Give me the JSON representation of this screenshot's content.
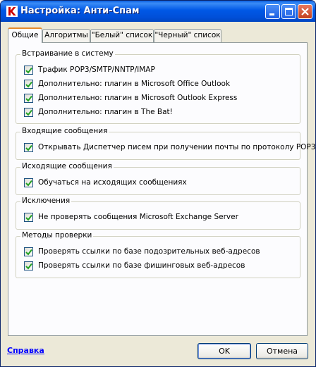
{
  "window": {
    "title": "Настройка: Анти-Спам",
    "icon": "kaspersky-k-icon"
  },
  "tabs": [
    {
      "label": "Общие",
      "active": true
    },
    {
      "label": "Алгоритмы",
      "active": false
    },
    {
      "label": "\"Белый\" список",
      "active": false
    },
    {
      "label": "\"Черный\" список",
      "active": false
    }
  ],
  "groups": [
    {
      "title": "Встраивание в систему",
      "items": [
        {
          "label": "Трафик POP3/SMTP/NNTP/IMAP",
          "checked": true
        },
        {
          "label": "Дополнительно: плагин в Microsoft Office Outlook",
          "checked": true
        },
        {
          "label": "Дополнительно: плагин в Microsoft Outlook Express",
          "checked": true
        },
        {
          "label": "Дополнительно: плагин в The Bat!",
          "checked": true
        }
      ]
    },
    {
      "title": "Входящие сообщения",
      "items": [
        {
          "label": "Открывать Диспетчер писем при получении почты по протоколу POP3",
          "checked": true
        }
      ]
    },
    {
      "title": "Исходящие сообщения",
      "items": [
        {
          "label": "Обучаться на исходящих сообщениях",
          "checked": true
        }
      ]
    },
    {
      "title": "Исключения",
      "items": [
        {
          "label": "Не проверять сообщения Microsoft Exchange Server",
          "checked": true
        }
      ]
    },
    {
      "title": "Методы проверки",
      "items": [
        {
          "label": "Проверять ссылки по базе подозрительных веб-адресов",
          "checked": true
        },
        {
          "label": "Проверять ссылки по базе фишинговых веб-адресов",
          "checked": true
        }
      ]
    }
  ],
  "footer": {
    "help_label": "Справка",
    "ok_label": "OK",
    "cancel_label": "Отмена"
  },
  "colors": {
    "titlebar": "#0058e6",
    "tab_highlight": "#e68b2c",
    "link": "#0000ff",
    "check_mark": "#21a121"
  }
}
